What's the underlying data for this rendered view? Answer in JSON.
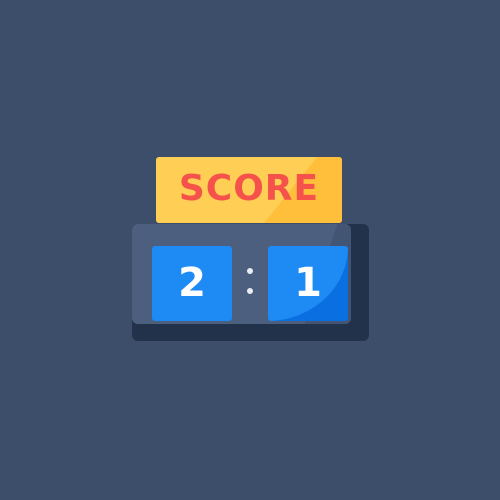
{
  "scoreboard": {
    "sign_label": "SCORE",
    "home_score": "2",
    "separator": ":",
    "away_score": "1"
  },
  "colors": {
    "background": "#3c4e6a",
    "sign": "#ffce54",
    "sign_text": "#f4524a",
    "board": "#4c5f7e",
    "board_shadow": "#23324b",
    "digit_panel": "#1e8af3",
    "digit_text": "#ffffff"
  },
  "icon": "scoreboard-icon"
}
